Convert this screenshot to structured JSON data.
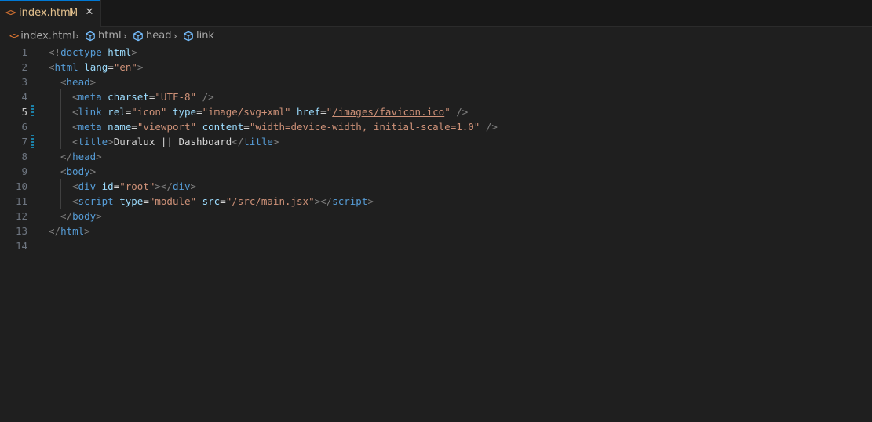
{
  "tab": {
    "icon": "<>",
    "filename": "index.html",
    "badge": "M",
    "close": "✕"
  },
  "breadcrumb": {
    "file": "index.html",
    "items": [
      "html",
      "head",
      "link"
    ],
    "separator": "›"
  },
  "colors": {
    "background": "#1f1f1f",
    "tag": "#569cd6",
    "attribute": "#9cdcfe",
    "string": "#ce9178",
    "bracket": "#808080",
    "modified": "#e2c08d",
    "html_icon": "#e37933"
  },
  "editor": {
    "line_numbers": [
      "1",
      "2",
      "3",
      "4",
      "5",
      "6",
      "7",
      "8",
      "9",
      "10",
      "11",
      "12",
      "13",
      "14"
    ],
    "active_line": 5,
    "lines": {
      "l1": {
        "a": "<!",
        "b": "doctype",
        "c": " ",
        "d": "html",
        "e": ">"
      },
      "l2": {
        "a": "<",
        "b": "html",
        "c": " lang",
        "d": "=",
        "e": "\"en\"",
        "f": ">"
      },
      "l3": {
        "a": "<",
        "b": "head",
        "c": ">"
      },
      "l4": {
        "a": "<",
        "b": "meta",
        "c": " charset",
        "d": "=",
        "e": "\"UTF-8\"",
        "f": " />"
      },
      "l5": {
        "a": "<",
        "b": "link",
        "c": " rel",
        "d": "=",
        "e": "\"icon\"",
        "f": " type",
        "g": "=",
        "h": "\"image/svg+xml\"",
        "i": " href",
        "j": "=",
        "k": "\"",
        "l": "/images/favicon.ico",
        "m": "\"",
        "n": " />"
      },
      "l6": {
        "a": "<",
        "b": "meta",
        "c": " name",
        "d": "=",
        "e": "\"viewport\"",
        "f": " content",
        "g": "=",
        "h": "\"width=device-width, initial-scale=1.0\"",
        "i": " />"
      },
      "l7": {
        "a": "<",
        "b": "title",
        "c": ">",
        "d": "Duralux || Dashboard",
        "e": "</",
        "f": "title",
        "g": ">"
      },
      "l8": {
        "a": "</",
        "b": "head",
        "c": ">"
      },
      "l9": {
        "a": "<",
        "b": "body",
        "c": ">"
      },
      "l10": {
        "a": "<",
        "b": "div",
        "c": " id",
        "d": "=",
        "e": "\"root\"",
        "f": "></",
        "g": "div",
        "h": ">"
      },
      "l11": {
        "a": "<",
        "b": "script",
        "c": " type",
        "d": "=",
        "e": "\"module\"",
        "f": " src",
        "g": "=",
        "h": "\"",
        "i": "/src/main.jsx",
        "j": "\"",
        "k": "></",
        "l": "script",
        "m": ">"
      },
      "l12": {
        "a": "</",
        "b": "body",
        "c": ">"
      },
      "l13": {
        "a": "</",
        "b": "html",
        "c": ">"
      }
    }
  }
}
